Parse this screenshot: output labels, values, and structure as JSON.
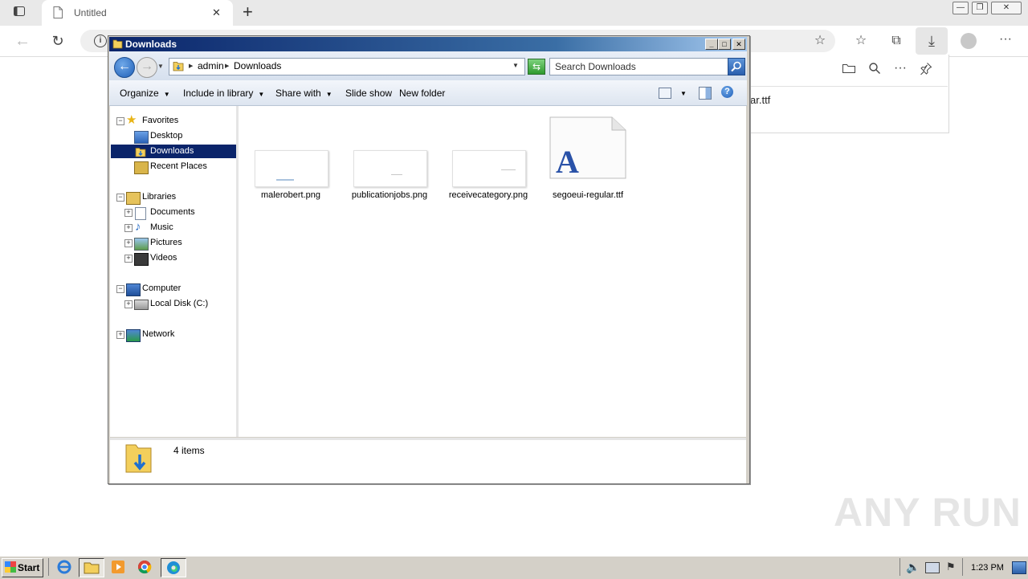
{
  "browser": {
    "tab_title": "Untitled",
    "tab_close": "✕",
    "new_tab": "+",
    "toolbar_more": "···",
    "download_panel": {
      "filename_fragment": "ar.ttf",
      "more": "···"
    }
  },
  "explorer": {
    "title": "Downloads",
    "breadcrumb": [
      "admin",
      "Downloads"
    ],
    "search_placeholder": "Search Downloads",
    "commands": {
      "organize": "Organize",
      "include_in_library": "Include in library",
      "share_with": "Share with",
      "slide_show": "Slide show",
      "new_folder": "New folder"
    },
    "nav": {
      "favorites": "Favorites",
      "desktop": "Desktop",
      "downloads": "Downloads",
      "recent_places": "Recent Places",
      "libraries": "Libraries",
      "documents": "Documents",
      "music": "Music",
      "pictures": "Pictures",
      "videos": "Videos",
      "computer": "Computer",
      "local_disk": "Local Disk (C:)",
      "network": "Network"
    },
    "files": [
      {
        "name": "malerobert.png"
      },
      {
        "name": "publicationjobs.png"
      },
      {
        "name": "receivecategory.png"
      },
      {
        "name": "segoeui-regular.ttf"
      }
    ],
    "status": "4 items"
  },
  "taskbar": {
    "start": "Start",
    "clock": "1:23 PM"
  },
  "watermark": "ANY RUN",
  "colors": {
    "title_gradient_start": "#0a246a",
    "title_gradient_end": "#a6caf0",
    "selection": "#0a246a",
    "taskbar": "#d4d0c8"
  }
}
